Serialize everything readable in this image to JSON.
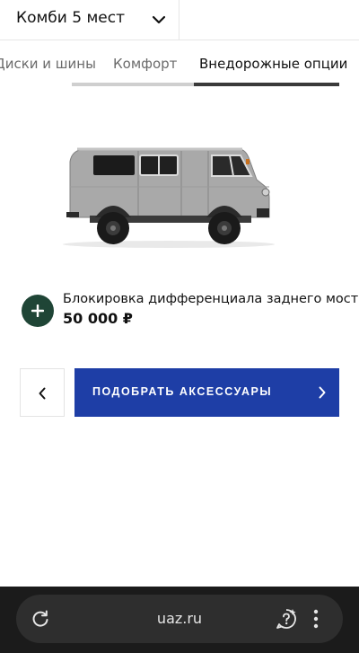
{
  "config": {
    "label": "Комби 5 мест",
    "chevron_icon": "chevron-down-icon"
  },
  "tabs": [
    {
      "label": "Диски и шины",
      "active": false
    },
    {
      "label": "Комфорт",
      "active": false
    },
    {
      "label": "Внедорожные опции",
      "active": true
    }
  ],
  "vehicle": {
    "image_icon": "van-image"
  },
  "option": {
    "name": "Блокировка дифференциала заднего моста",
    "price": "50 000 ₽",
    "add_icon": "plus-icon"
  },
  "actions": {
    "back_icon": "chevron-left-icon",
    "primary_label": "ПОДОБРАТЬ АКСЕССУАРЫ",
    "primary_icon": "chevron-right-icon"
  },
  "browser": {
    "url": "uaz.ru",
    "reload_icon": "reload-icon",
    "assist_icon": "assistant-icon",
    "menu_icon": "more-vert-icon"
  },
  "colors": {
    "accent_blue": "#1e3ea6",
    "add_button_green": "#1f4536",
    "browser_bar": "#1b1b1b"
  }
}
